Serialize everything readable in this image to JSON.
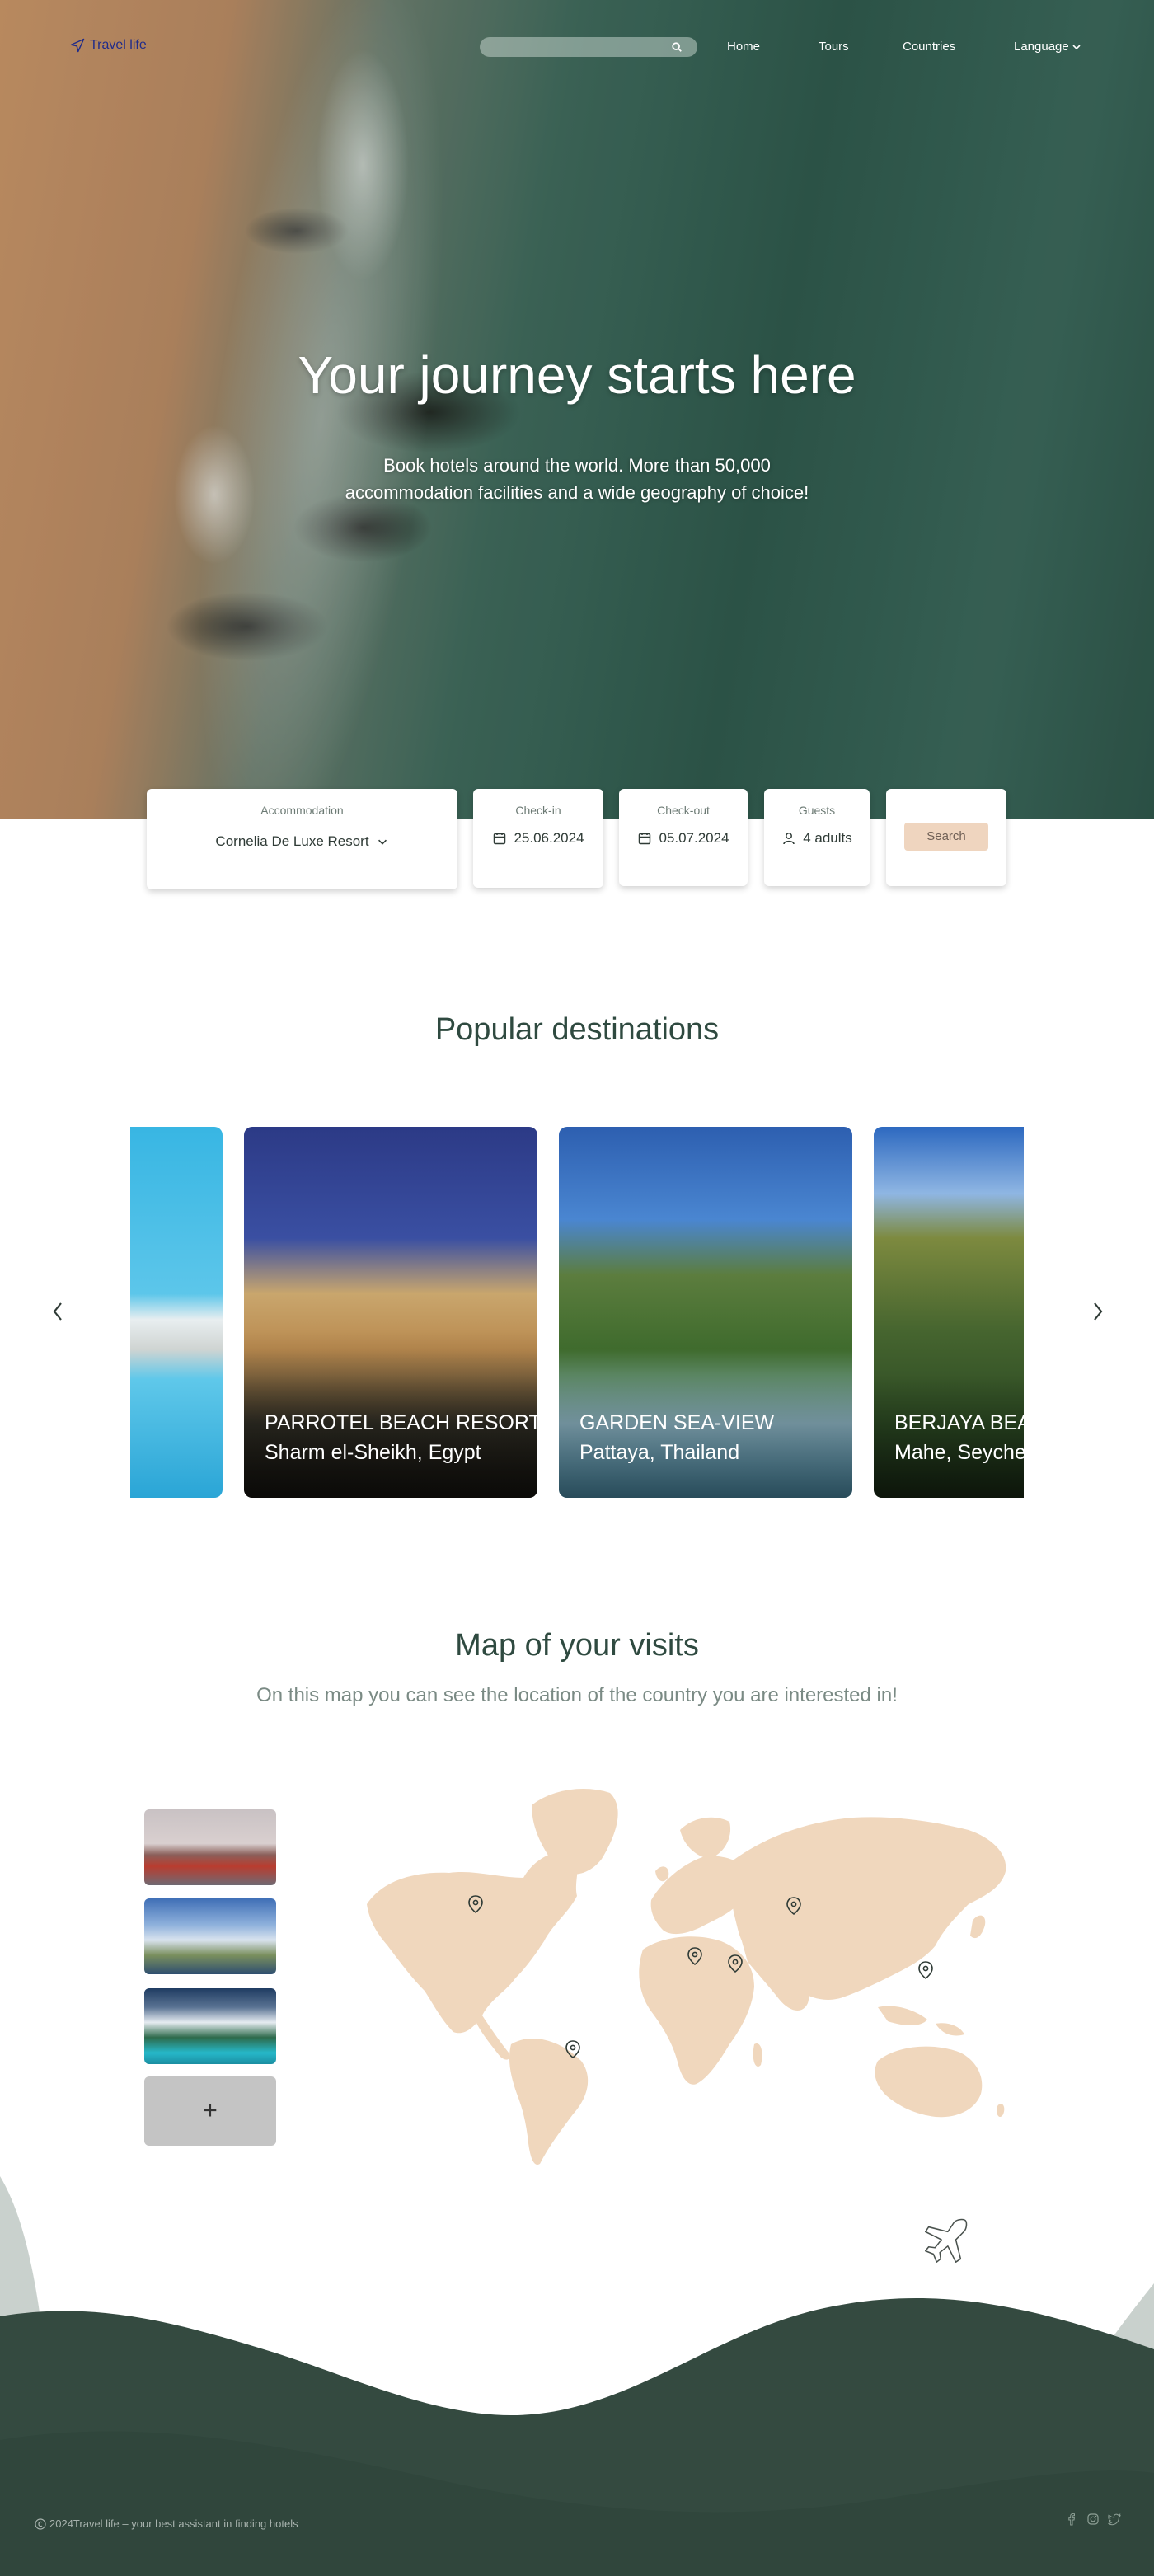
{
  "nav": {
    "logo": "Travel life",
    "links": [
      "Home",
      "Tours",
      "Countries",
      "Language"
    ]
  },
  "hero": {
    "title": "Your journey starts here",
    "subtitle": "Book hotels around the world. More than 50,000 accommodation facilities and a wide geography of choice!"
  },
  "booking": {
    "accommodation_label": "Accommodation",
    "accommodation_value": "Cornelia De Luxe Resort",
    "checkin_label": "Check-in",
    "checkin_value": "25.06.2024",
    "checkout_label": "Check-out",
    "checkout_value": "05.07.2024",
    "guests_label": "Guests",
    "guests_value": "4 adults",
    "search_label": "Search"
  },
  "popular": {
    "title": "Popular destinations",
    "slides": [
      {
        "name": "",
        "location": ""
      },
      {
        "name": "PARROTEL BEACH RESORT",
        "location": "Sharm el-Sheikh, Egypt"
      },
      {
        "name": "GARDEN SEA-VIEW",
        "location": "Pattaya, Thailand"
      },
      {
        "name": "BERJAYA BEAU",
        "location": "Mahe, Seychel"
      }
    ]
  },
  "map": {
    "title": "Map of your visits",
    "subtitle": "On this map you can see the location of the country you are interested in!",
    "add_label": "+"
  },
  "footer": {
    "copyright": "2024Travel life – your best assistant in finding hotels"
  },
  "colors": {
    "accent": "#efd5bf",
    "dark_green": "#344a40",
    "map_land": "#f0d7bd"
  }
}
